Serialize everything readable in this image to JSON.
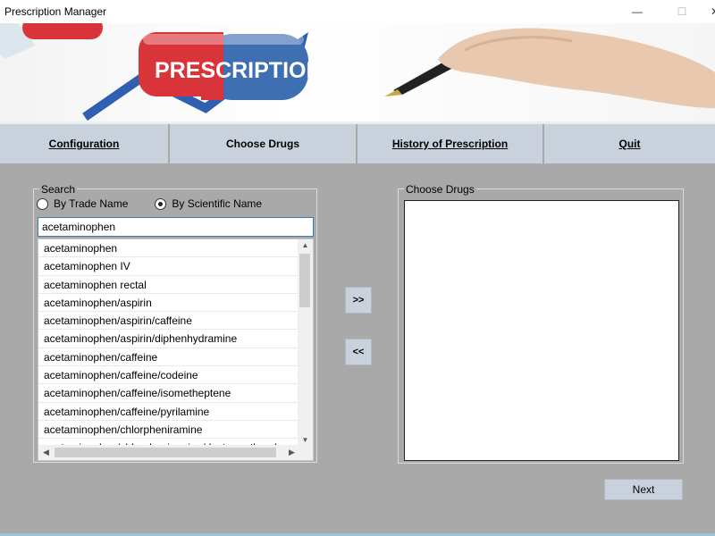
{
  "window": {
    "title": "Prescription Manager",
    "minimize_glyph": "—",
    "maximize_glyph": "☐",
    "close_glyph": "✕"
  },
  "banner": {
    "pill_text": "PRESCRIPTION"
  },
  "nav": {
    "configuration": "Configuration",
    "choose_drugs": "Choose Drugs",
    "history": "History of Prescription",
    "quit": "Quit"
  },
  "search": {
    "group_label": "Search",
    "radio_trade": "By Trade Name",
    "radio_scientific": "By Scientific Name",
    "selected_radio": "scientific",
    "input_value": "acetaminophen"
  },
  "results": [
    "acetaminophen",
    "acetaminophen IV",
    "acetaminophen rectal",
    "acetaminophen/aspirin",
    "acetaminophen/aspirin/caffeine",
    "acetaminophen/aspirin/diphenhydramine",
    "acetaminophen/caffeine",
    "acetaminophen/caffeine/codeine",
    "acetaminophen/caffeine/isometheptene",
    "acetaminophen/caffeine/pyrilamine",
    "acetaminophen/chlorpheniramine",
    "acetaminophen/chlorpheniramine/dextromethorphan"
  ],
  "buttons": {
    "add": ">>",
    "remove": "<<",
    "next": "Next"
  },
  "choose": {
    "group_label": "Choose Drugs",
    "items": []
  },
  "colors": {
    "background": "#a9a9a9",
    "button": "#c9d2dc",
    "pill_red": "#d9343a",
    "pill_blue": "#3f6fb3"
  }
}
